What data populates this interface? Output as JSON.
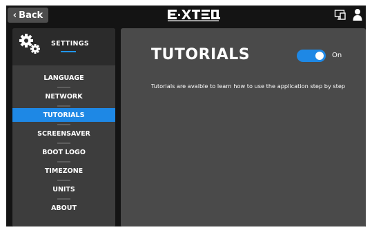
{
  "topbar": {
    "back_label": "Back",
    "logo_text": "E·XTEQ",
    "icons": [
      "device-icon",
      "user-icon"
    ]
  },
  "sidebar": {
    "header_label": "SETTINGS",
    "items": [
      {
        "label": "LANGUAGE",
        "active": false
      },
      {
        "label": "NETWORK",
        "active": false
      },
      {
        "label": "TUTORIALS",
        "active": true
      },
      {
        "label": "SCREENSAVER",
        "active": false
      },
      {
        "label": "BOOT LOGO",
        "active": false
      },
      {
        "label": "TIMEZONE",
        "active": false
      },
      {
        "label": "UNITS",
        "active": false
      },
      {
        "label": "ABOUT",
        "active": false
      }
    ]
  },
  "main": {
    "title": "TUTORIALS",
    "toggle_state": "on",
    "toggle_label": "On",
    "description": "Tutorials are avaible to learn how to use the application step by step"
  },
  "colors": {
    "accent": "#1e88e5",
    "background": "#141414",
    "panel": "#4a4a4a",
    "sidebar": "#3d3d3d"
  }
}
